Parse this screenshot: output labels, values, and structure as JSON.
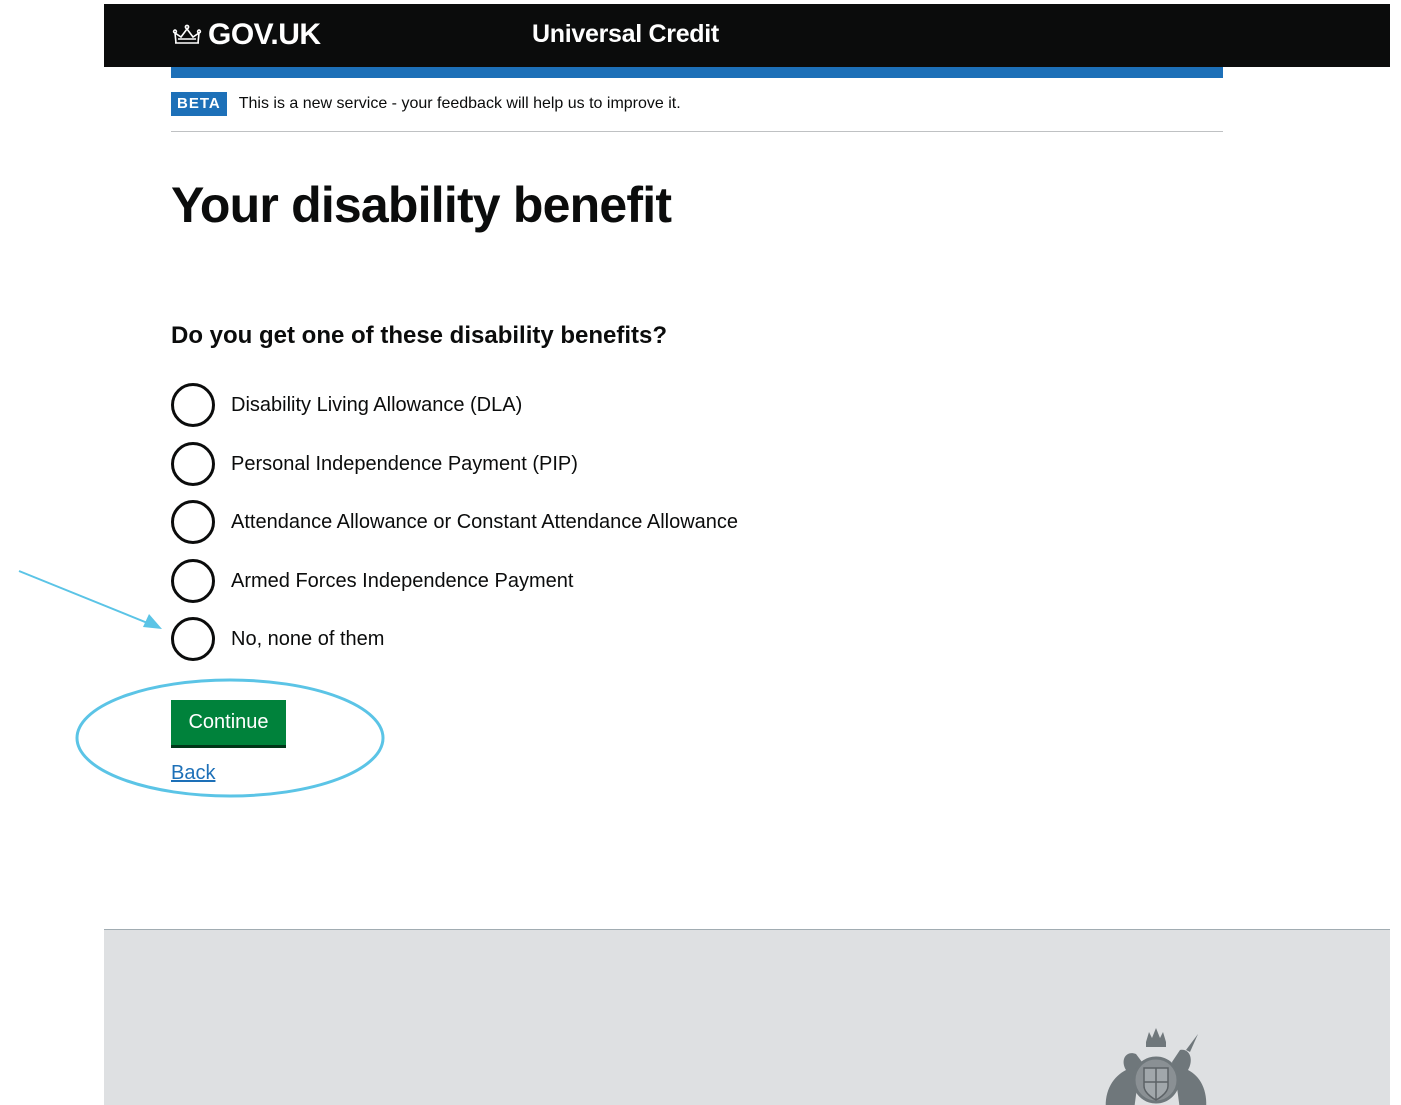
{
  "header": {
    "logo_text": "GOV.UK",
    "service_name": "Universal Credit"
  },
  "phase_banner": {
    "tag": "BETA",
    "text": "This is a new service - your feedback will help us to improve it."
  },
  "page": {
    "title": "Your disability benefit",
    "question": "Do you get one of these disability benefits?",
    "options": [
      {
        "label": "Disability Living Allowance (DLA)"
      },
      {
        "label": "Personal Independence Payment (PIP)"
      },
      {
        "label": "Attendance Allowance or Constant Attendance Allowance"
      },
      {
        "label": "Armed Forces Independence Payment"
      },
      {
        "label": "No, none of them"
      }
    ],
    "continue_label": "Continue",
    "back_label": "Back"
  },
  "colors": {
    "header_bg": "#0b0c0c",
    "accent_blue": "#1d70b8",
    "button_green": "#00823b",
    "annotation": "#5bc4e6",
    "footer_bg": "#dee0e2"
  },
  "icons": {
    "logo": "crown-icon",
    "footer": "royal-coat-of-arms-icon",
    "annotation": "arrow-annotation"
  }
}
